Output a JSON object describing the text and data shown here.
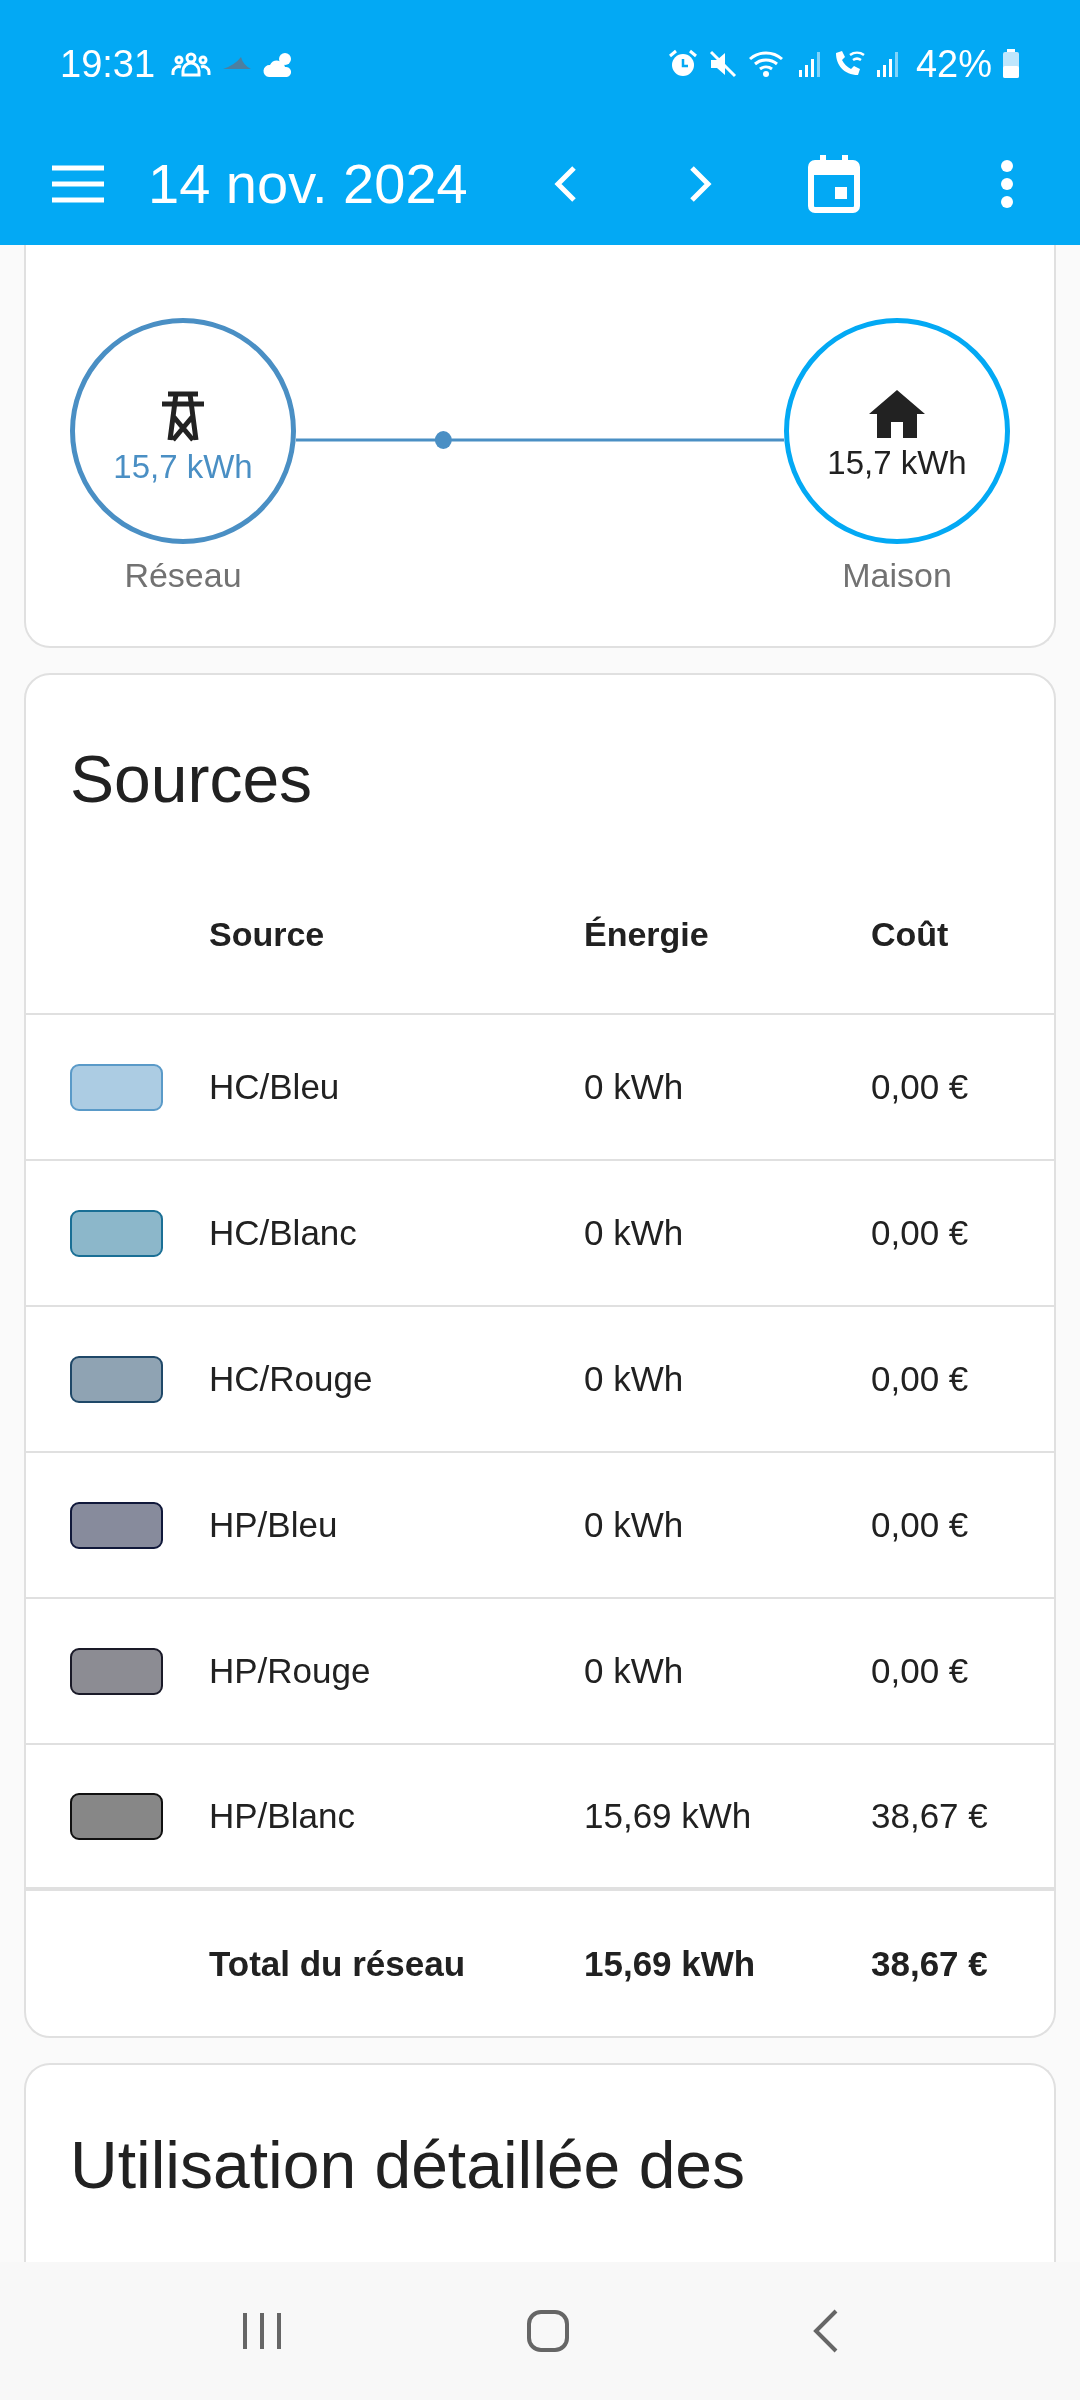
{
  "status_bar": {
    "time": "19:31",
    "battery": "42%"
  },
  "toolbar": {
    "title": "14 nov. 2024"
  },
  "distribution": {
    "nodes": [
      {
        "kind": "grid",
        "value": "15,7 kWh",
        "label": "Réseau"
      },
      {
        "kind": "home",
        "value": "15,7 kWh",
        "label": "Maison"
      }
    ]
  },
  "sources": {
    "title": "Sources",
    "columns": [
      "Source",
      "Énergie",
      "Coût"
    ],
    "rows": [
      {
        "color": "#5a9ac8",
        "source": "HC/Bleu",
        "energy": "0 kWh",
        "cost": "0,00 €"
      },
      {
        "color": "#1a6f95",
        "source": "HC/Blanc",
        "energy": "0 kWh",
        "cost": "0,00 €"
      },
      {
        "color": "#1f4868",
        "source": "HC/Rouge",
        "energy": "0 kWh",
        "cost": "0,00 €"
      },
      {
        "color": "#10183a",
        "source": "HP/Bleu",
        "energy": "0 kWh",
        "cost": "0,00 €"
      },
      {
        "color": "#1a1a28",
        "source": "HP/Rouge",
        "energy": "0 kWh",
        "cost": "0,00 €"
      },
      {
        "color": "#101010",
        "source": "HP/Blanc",
        "energy": "15,69 kWh",
        "cost": "38,67 €"
      }
    ],
    "total": {
      "label": "Total du réseau",
      "energy": "15,69 kWh",
      "cost": "38,67 €"
    }
  },
  "usage": {
    "title": "Utilisation détaillée des"
  }
}
